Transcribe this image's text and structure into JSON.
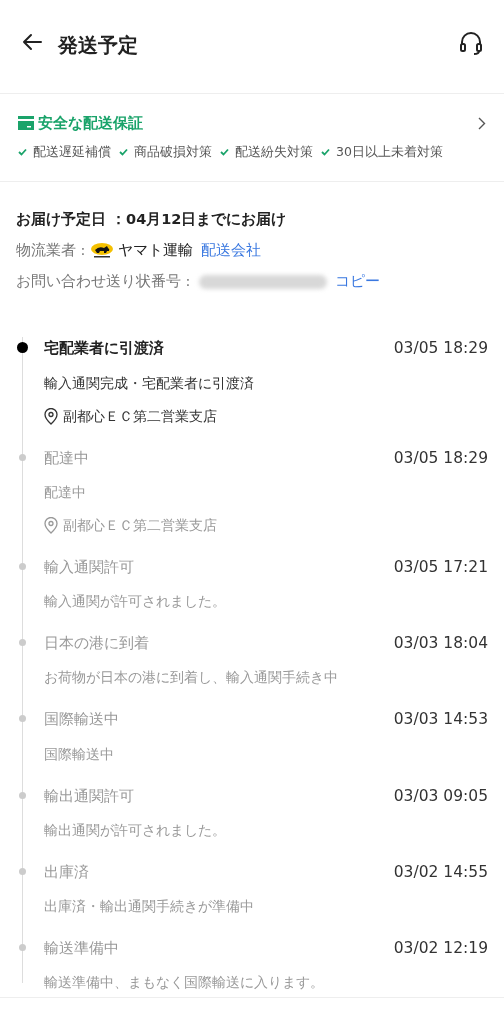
{
  "header": {
    "title": "発送予定"
  },
  "guarantee": {
    "title": "安全な配送保証",
    "items": [
      "配送遅延補償",
      "商品破損対策",
      "配送紛失対策",
      "30日以上未着対策"
    ]
  },
  "delivery": {
    "date_label": "お届け予定日 ：04月12日までにお届け",
    "carrier_label": "物流業者 :",
    "carrier_name": "ヤマト運輸",
    "carrier_link": "配送会社",
    "tracking_label": "お問い合わせ送り状番号 :",
    "copy_link": "コピー"
  },
  "events": [
    {
      "title": "宅配業者に引渡済",
      "time": "03/05 18:29",
      "description": "輸入通関完成・宅配業者に引渡済",
      "location": "副都心ＥＣ第二営業支店",
      "current": true
    },
    {
      "title": "配達中",
      "time": "03/05 18:29",
      "description": "配達中",
      "location": "副都心ＥＣ第二営業支店",
      "current": false
    },
    {
      "title": "輸入通関許可",
      "time": "03/05 17:21",
      "description": "輸入通関が許可されました。",
      "current": false
    },
    {
      "title": "日本の港に到着",
      "time": "03/03 18:04",
      "description": "お荷物が日本の港に到着し、輸入通関手続き中",
      "current": false
    },
    {
      "title": "国際輸送中",
      "time": "03/03 14:53",
      "description": "国際輸送中",
      "current": false
    },
    {
      "title": "輸出通関許可",
      "time": "03/03 09:05",
      "description": "輸出通関が許可されました。",
      "current": false
    },
    {
      "title": "出庫済",
      "time": "03/02 14:55",
      "description": "出庫済・輸出通関手続きが準備中",
      "current": false
    },
    {
      "title": "輸送準備中",
      "time": "03/02 12:19",
      "description": "輸送準備中、まもなく国際輸送に入ります。",
      "current": false
    }
  ]
}
